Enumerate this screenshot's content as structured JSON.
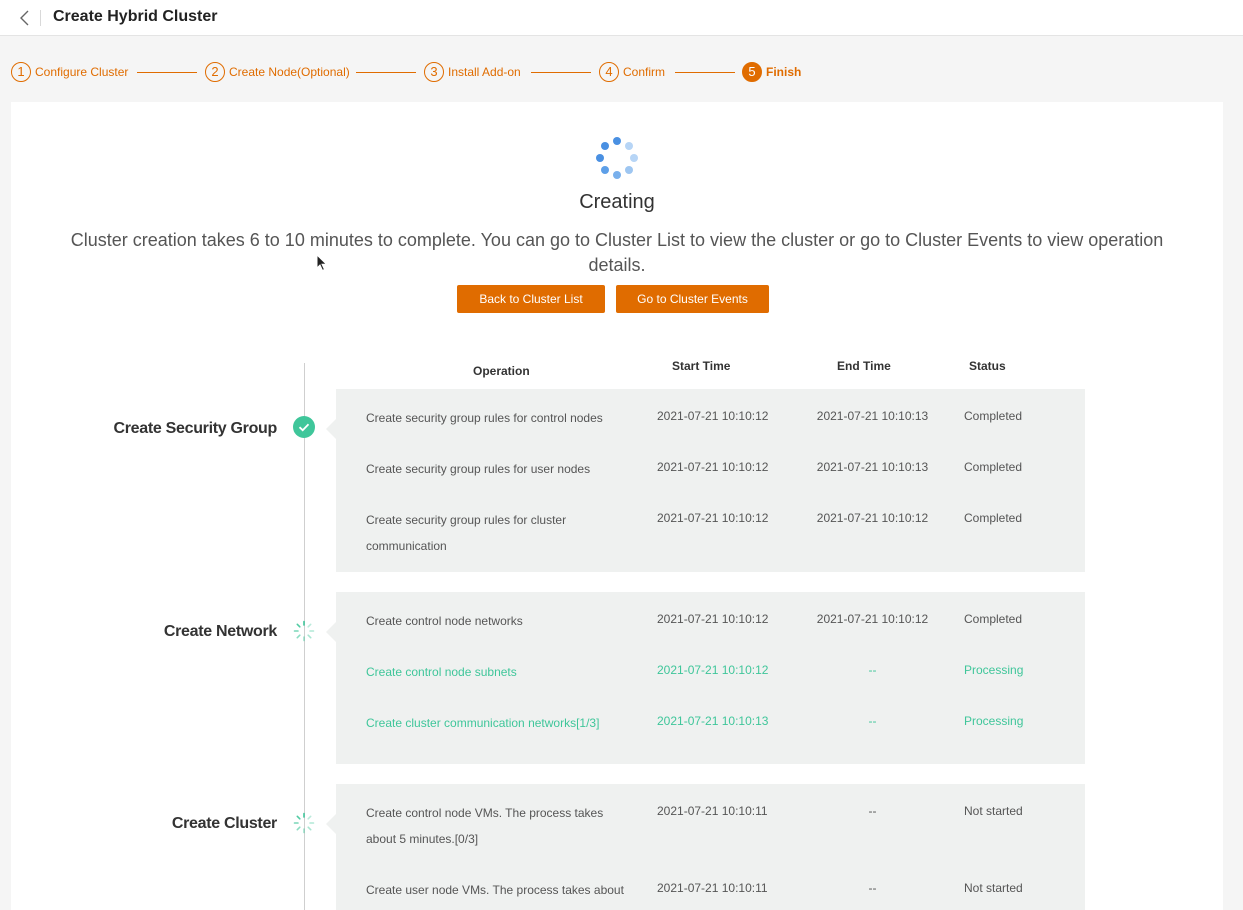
{
  "header": {
    "title": "Create Hybrid Cluster"
  },
  "steps": [
    {
      "num": "1",
      "label": "Configure Cluster"
    },
    {
      "num": "2",
      "label": "Create Node(Optional)"
    },
    {
      "num": "3",
      "label": "Install Add-on"
    },
    {
      "num": "4",
      "label": "Confirm"
    },
    {
      "num": "5",
      "label": "Finish"
    }
  ],
  "status_card": {
    "heading": "Creating",
    "description": "Cluster creation takes 6 to 10 minutes to complete. You can go to Cluster List to view the cluster or go to Cluster Events to view operation details.",
    "back_button": "Back to Cluster List",
    "events_button": "Go to Cluster Events"
  },
  "table": {
    "columns": [
      "Operation",
      "Start Time",
      "End Time",
      "Status"
    ],
    "stages": [
      {
        "name": "Create Security Group",
        "state": "completed",
        "rows": [
          {
            "operation": "Create security group rules for control nodes",
            "start": "2021-07-21 10:10:12",
            "end": "2021-07-21 10:10:13",
            "status": "Completed"
          },
          {
            "operation": "Create security group rules for user nodes",
            "start": "2021-07-21 10:10:12",
            "end": "2021-07-21 10:10:13",
            "status": "Completed"
          },
          {
            "operation": "Create security group rules for cluster communication",
            "start": "2021-07-21 10:10:12",
            "end": "2021-07-21 10:10:12",
            "status": "Completed"
          }
        ]
      },
      {
        "name": "Create Network",
        "state": "processing",
        "rows": [
          {
            "operation": "Create control node networks",
            "start": "2021-07-21 10:10:12",
            "end": "2021-07-21 10:10:12",
            "status": "Completed"
          },
          {
            "operation": "Create control node subnets",
            "start": "2021-07-21 10:10:12",
            "end": "--",
            "status": "Processing"
          },
          {
            "operation": "Create cluster communication networks[1/3]",
            "start": "2021-07-21 10:10:13",
            "end": "--",
            "status": "Processing"
          }
        ]
      },
      {
        "name": "Create Cluster",
        "state": "processing",
        "rows": [
          {
            "operation": "Create control node VMs. The process takes about 5 minutes.[0/3]",
            "start": "2021-07-21 10:10:11",
            "end": "--",
            "status": "Not started"
          },
          {
            "operation": "Create user node VMs. The process takes about",
            "start": "2021-07-21 10:10:11",
            "end": "--",
            "status": "Not started"
          }
        ]
      }
    ]
  },
  "colors": {
    "accent": "#e06c00",
    "success": "#3fc69a",
    "spinner": "#4a90e2"
  },
  "icons": {
    "back": "chevron-left-icon",
    "done": "check-circle-icon",
    "loading": "loading-spinner-icon"
  }
}
